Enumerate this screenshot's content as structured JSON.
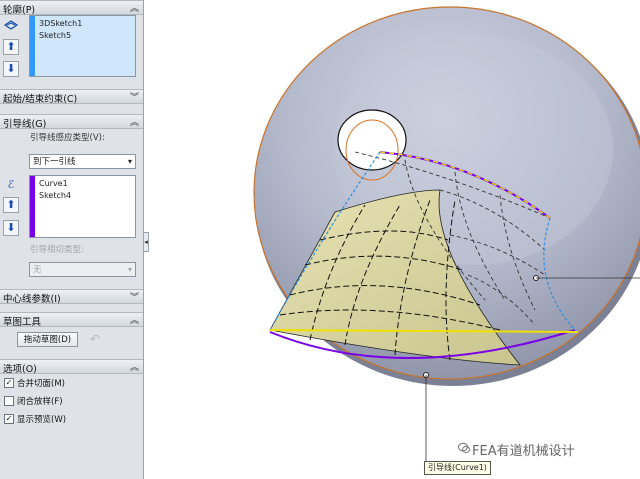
{
  "panel": {
    "profile": {
      "title": "轮廓(P)",
      "items": [
        "3DSketch1",
        "Sketch5"
      ]
    },
    "start_end": {
      "title": "起始/结束约束(C)"
    },
    "guides": {
      "title": "引导线(G)",
      "influence_label": "引导线感应类型(V):",
      "influence_value": "到下一引线",
      "items": [
        "Curve1",
        "Sketch4"
      ],
      "tangency_label": "引导相切类型:",
      "tangency_value": "无"
    },
    "centerline": {
      "title": "中心线参数(I)"
    },
    "sketch_tools": {
      "title": "草图工具",
      "drag_label": "拖动草图(D)"
    },
    "options": {
      "title": "选项(O)",
      "checkboxes": [
        {
          "label": "合并切面(M)",
          "checked": true
        },
        {
          "label": "闭合放样(F)",
          "checked": false
        },
        {
          "label": "显示预览(W)",
          "checked": true
        }
      ]
    }
  },
  "viewport": {
    "callout_label": "引导线(Curve1)",
    "watermark": "FEA有道机械设计"
  },
  "colors": {
    "accent_blue": "#3399ff",
    "accent_purple": "#7a00e6",
    "surface": "#dcd9a4",
    "dish": "#aeb3c6"
  }
}
